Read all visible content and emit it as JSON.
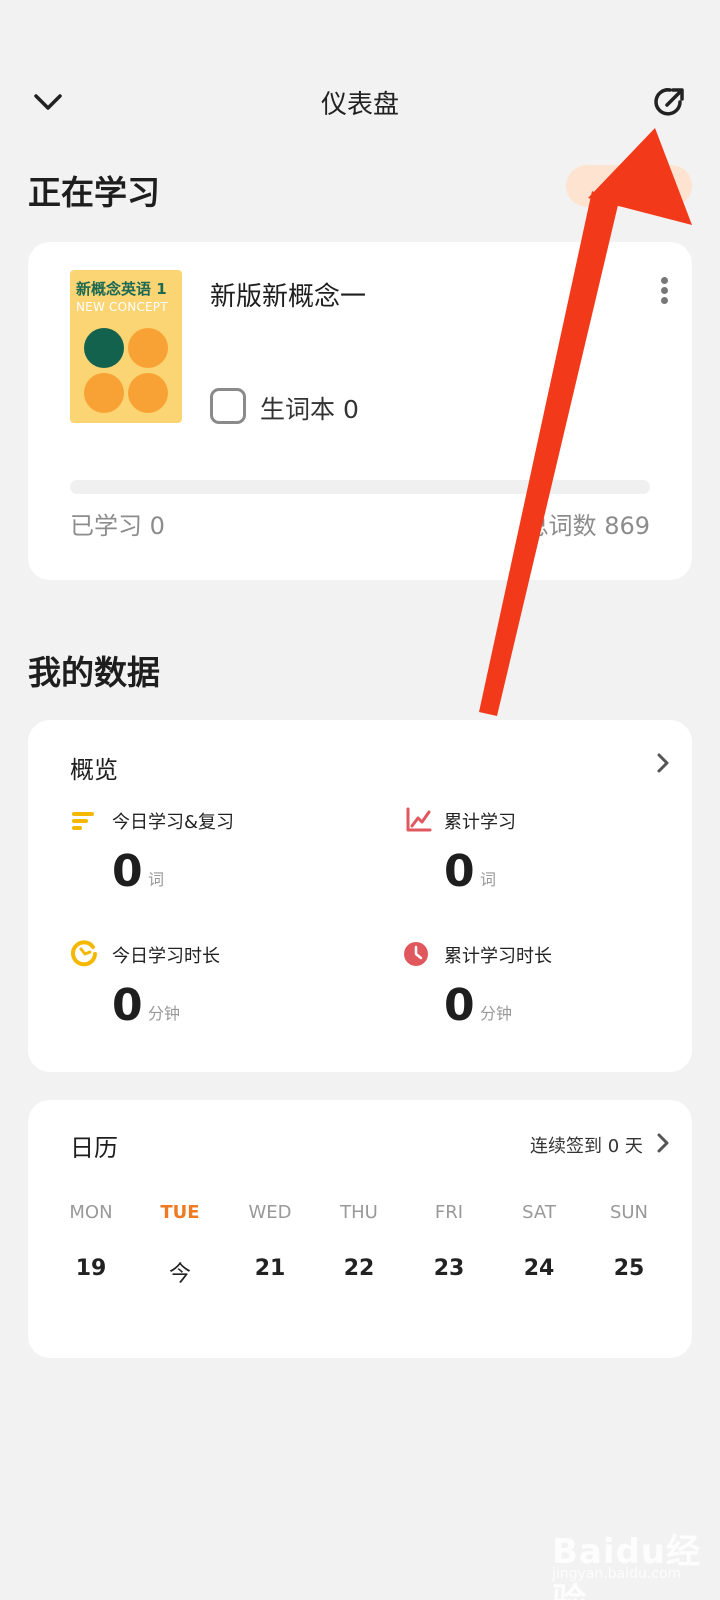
{
  "header": {
    "title": "仪表盘"
  },
  "studying": {
    "section_title": "正在学习",
    "switch_label": "换",
    "book": {
      "cover_title": "新概念英语 1",
      "cover_subtitle": "NEW CONCEPT",
      "name": "新版新概念一",
      "vocab_label": "生词本 0",
      "progress_fraction": 0,
      "learned_label": "已学习 0",
      "total_label": "总词数 869"
    }
  },
  "my_data": {
    "section_title": "我的数据",
    "overview": {
      "title": "概览",
      "stats": [
        {
          "label": "今日学习&复习",
          "value": "0",
          "unit": "词",
          "icon": "bars-icon",
          "color": "#f5b800"
        },
        {
          "label": "累计学习",
          "value": "0",
          "unit": "词",
          "icon": "line-chart-icon",
          "color": "#e0585e"
        },
        {
          "label": "今日学习时长",
          "value": "0",
          "unit": "分钟",
          "icon": "timer-icon",
          "color": "#f5b800"
        },
        {
          "label": "累计学习时长",
          "value": "0",
          "unit": "分钟",
          "icon": "clock-icon",
          "color": "#e0585e"
        }
      ]
    }
  },
  "calendar": {
    "title": "日历",
    "streak_label": "连续签到 0 天",
    "days": [
      {
        "name": "MON",
        "num": "19",
        "today": false
      },
      {
        "name": "TUE",
        "num": "今",
        "today": true
      },
      {
        "name": "WED",
        "num": "21",
        "today": false
      },
      {
        "name": "THU",
        "num": "22",
        "today": false
      },
      {
        "name": "FRI",
        "num": "23",
        "today": false
      },
      {
        "name": "SAT",
        "num": "24",
        "today": false
      },
      {
        "name": "SUN",
        "num": "25",
        "today": false
      }
    ]
  },
  "watermark": {
    "main": "Baidu经验",
    "sub": "jingyan.baidu.com"
  },
  "colors": {
    "accent": "#f07a22",
    "annotation_arrow": "#f23a1a"
  }
}
